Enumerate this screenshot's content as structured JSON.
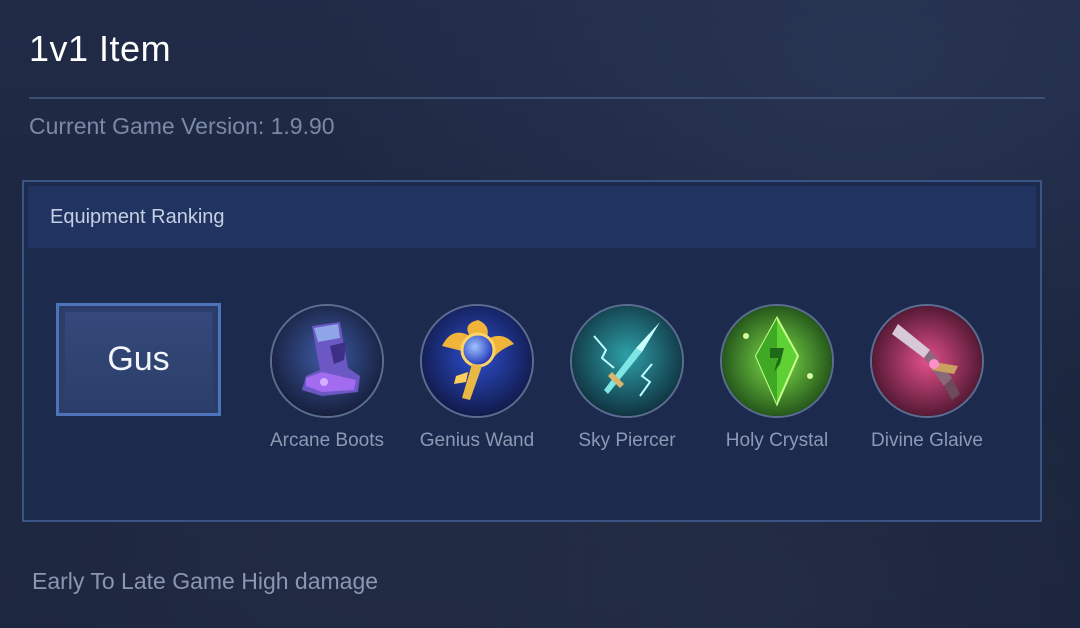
{
  "page": {
    "title": "1v1 Item",
    "version_text": "Current Game Version: 1.9.90",
    "note": "Early To Late Game High damage"
  },
  "panel": {
    "header": "Equipment Ranking",
    "hero_name": "Gus",
    "items": [
      {
        "label": "Arcane Boots",
        "icon": "arcane-boots-icon"
      },
      {
        "label": "Genius Wand",
        "icon": "genius-wand-icon"
      },
      {
        "label": "Sky Piercer",
        "icon": "sky-piercer-icon"
      },
      {
        "label": "Holy Crystal",
        "icon": "holy-crystal-icon"
      },
      {
        "label": "Divine Glaive",
        "icon": "divine-glaive-icon"
      }
    ]
  },
  "colors": {
    "panel_border": "#3a5584",
    "panel_header_bg": "#203361",
    "hero_border": "#4d74bb",
    "label_text": "#8c9ab4"
  }
}
